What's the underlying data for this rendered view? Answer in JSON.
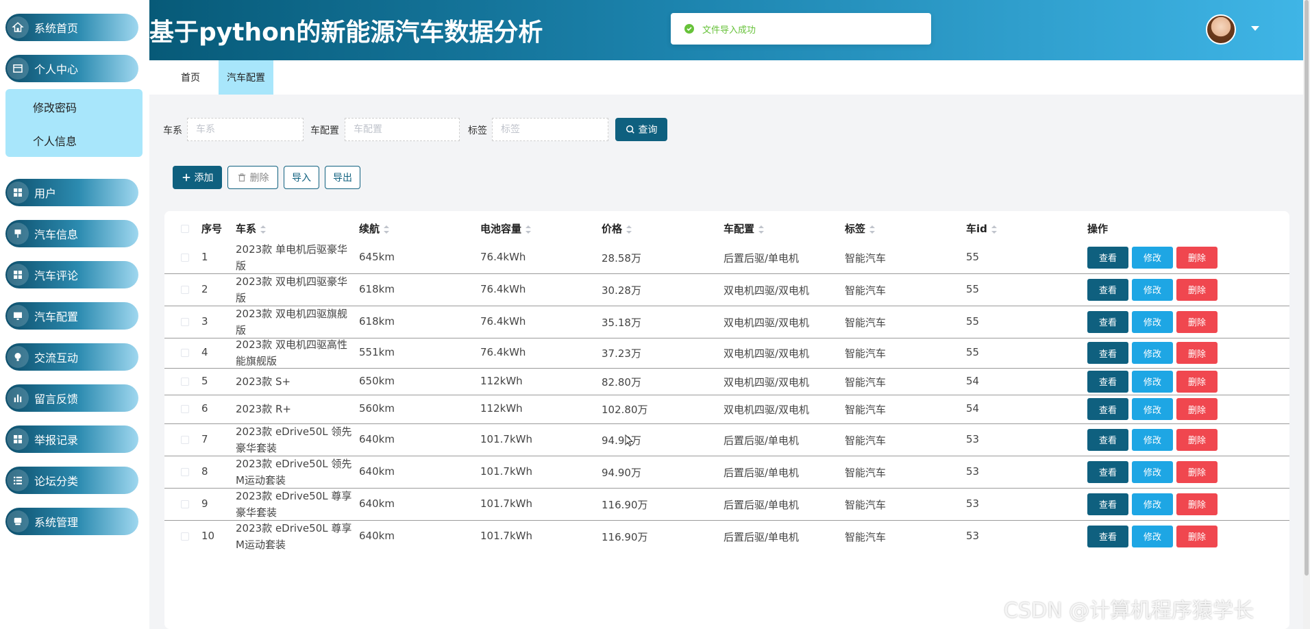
{
  "sidebar": {
    "items": [
      {
        "label": "系统首页",
        "icon": "home-icon"
      },
      {
        "label": "个人中心",
        "icon": "window-icon"
      },
      {
        "label": "用户",
        "icon": "grid-icon"
      },
      {
        "label": "汽车信息",
        "icon": "pin-icon"
      },
      {
        "label": "汽车评论",
        "icon": "grid-icon"
      },
      {
        "label": "汽车配置",
        "icon": "monitor-icon"
      },
      {
        "label": "交流互动",
        "icon": "bulb-icon"
      },
      {
        "label": "留言反馈",
        "icon": "bar-chart-icon"
      },
      {
        "label": "举报记录",
        "icon": "grid-icon"
      },
      {
        "label": "论坛分类",
        "icon": "list-icon"
      },
      {
        "label": "系统管理",
        "icon": "box-icon"
      }
    ],
    "submenu": [
      "修改密码",
      "个人信息"
    ]
  },
  "header": {
    "title": "基于python的新能源汽车数据分析",
    "toast": "文件导入成功"
  },
  "tabs": [
    "首页",
    "汽车配置"
  ],
  "search": {
    "fields": [
      {
        "label": "车系",
        "placeholder": "车系"
      },
      {
        "label": "车配置",
        "placeholder": "车配置"
      },
      {
        "label": "标签",
        "placeholder": "标签"
      }
    ],
    "query_label": "查询"
  },
  "toolbar": {
    "add_label": "添加",
    "delete_label": "删除",
    "import_label": "导入",
    "export_label": "导出"
  },
  "table": {
    "headers": [
      "序号",
      "车系",
      "续航",
      "电池容量",
      "价格",
      "车配置",
      "标签",
      "车id",
      "操作"
    ],
    "actions": [
      "查看",
      "修改",
      "删除"
    ],
    "rows": [
      {
        "no": "1",
        "series": "2023款 单电机后驱豪华版",
        "range": "645km",
        "battery": "76.4kWh",
        "price": "28.58万",
        "config": "后置后驱/单电机",
        "tag": "智能汽车",
        "id": "55"
      },
      {
        "no": "2",
        "series": "2023款 双电机四驱豪华版",
        "range": "618km",
        "battery": "76.4kWh",
        "price": "30.28万",
        "config": "双电机四驱/双电机",
        "tag": "智能汽车",
        "id": "55"
      },
      {
        "no": "3",
        "series": "2023款 双电机四驱旗舰版",
        "range": "618km",
        "battery": "76.4kWh",
        "price": "35.18万",
        "config": "双电机四驱/双电机",
        "tag": "智能汽车",
        "id": "55"
      },
      {
        "no": "4",
        "series": "2023款 双电机四驱高性能旗舰版",
        "range": "551km",
        "battery": "76.4kWh",
        "price": "37.23万",
        "config": "双电机四驱/双电机",
        "tag": "智能汽车",
        "id": "55"
      },
      {
        "no": "5",
        "series": "2023款 S+",
        "range": "650km",
        "battery": "112kWh",
        "price": "82.80万",
        "config": "双电机四驱/双电机",
        "tag": "智能汽车",
        "id": "54"
      },
      {
        "no": "6",
        "series": "2023款 R+",
        "range": "560km",
        "battery": "112kWh",
        "price": "102.80万",
        "config": "双电机四驱/双电机",
        "tag": "智能汽车",
        "id": "54"
      },
      {
        "no": "7",
        "series": "2023款 eDrive50L 领先豪华套装",
        "range": "640km",
        "battery": "101.7kWh",
        "price": "94.90万",
        "config": "后置后驱/单电机",
        "tag": "智能汽车",
        "id": "53"
      },
      {
        "no": "8",
        "series": "2023款 eDrive50L 领先M运动套装",
        "range": "640km",
        "battery": "101.7kWh",
        "price": "94.90万",
        "config": "后置后驱/单电机",
        "tag": "智能汽车",
        "id": "53"
      },
      {
        "no": "9",
        "series": "2023款 eDrive50L 尊享豪华套装",
        "range": "640km",
        "battery": "101.7kWh",
        "price": "116.90万",
        "config": "后置后驱/单电机",
        "tag": "智能汽车",
        "id": "53"
      },
      {
        "no": "10",
        "series": "2023款 eDrive50L 尊享M运动套装",
        "range": "640km",
        "battery": "101.7kWh",
        "price": "116.90万",
        "config": "后置后驱/单电机",
        "tag": "智能汽车",
        "id": "53"
      }
    ]
  },
  "watermark": "CSDN @计算机程序猿学长",
  "colors": {
    "primary": "#0f607f",
    "edit": "#1ea6e4",
    "danger": "#f0474f",
    "submenu_bg": "#a8e6fb",
    "success": "#67c23a"
  }
}
